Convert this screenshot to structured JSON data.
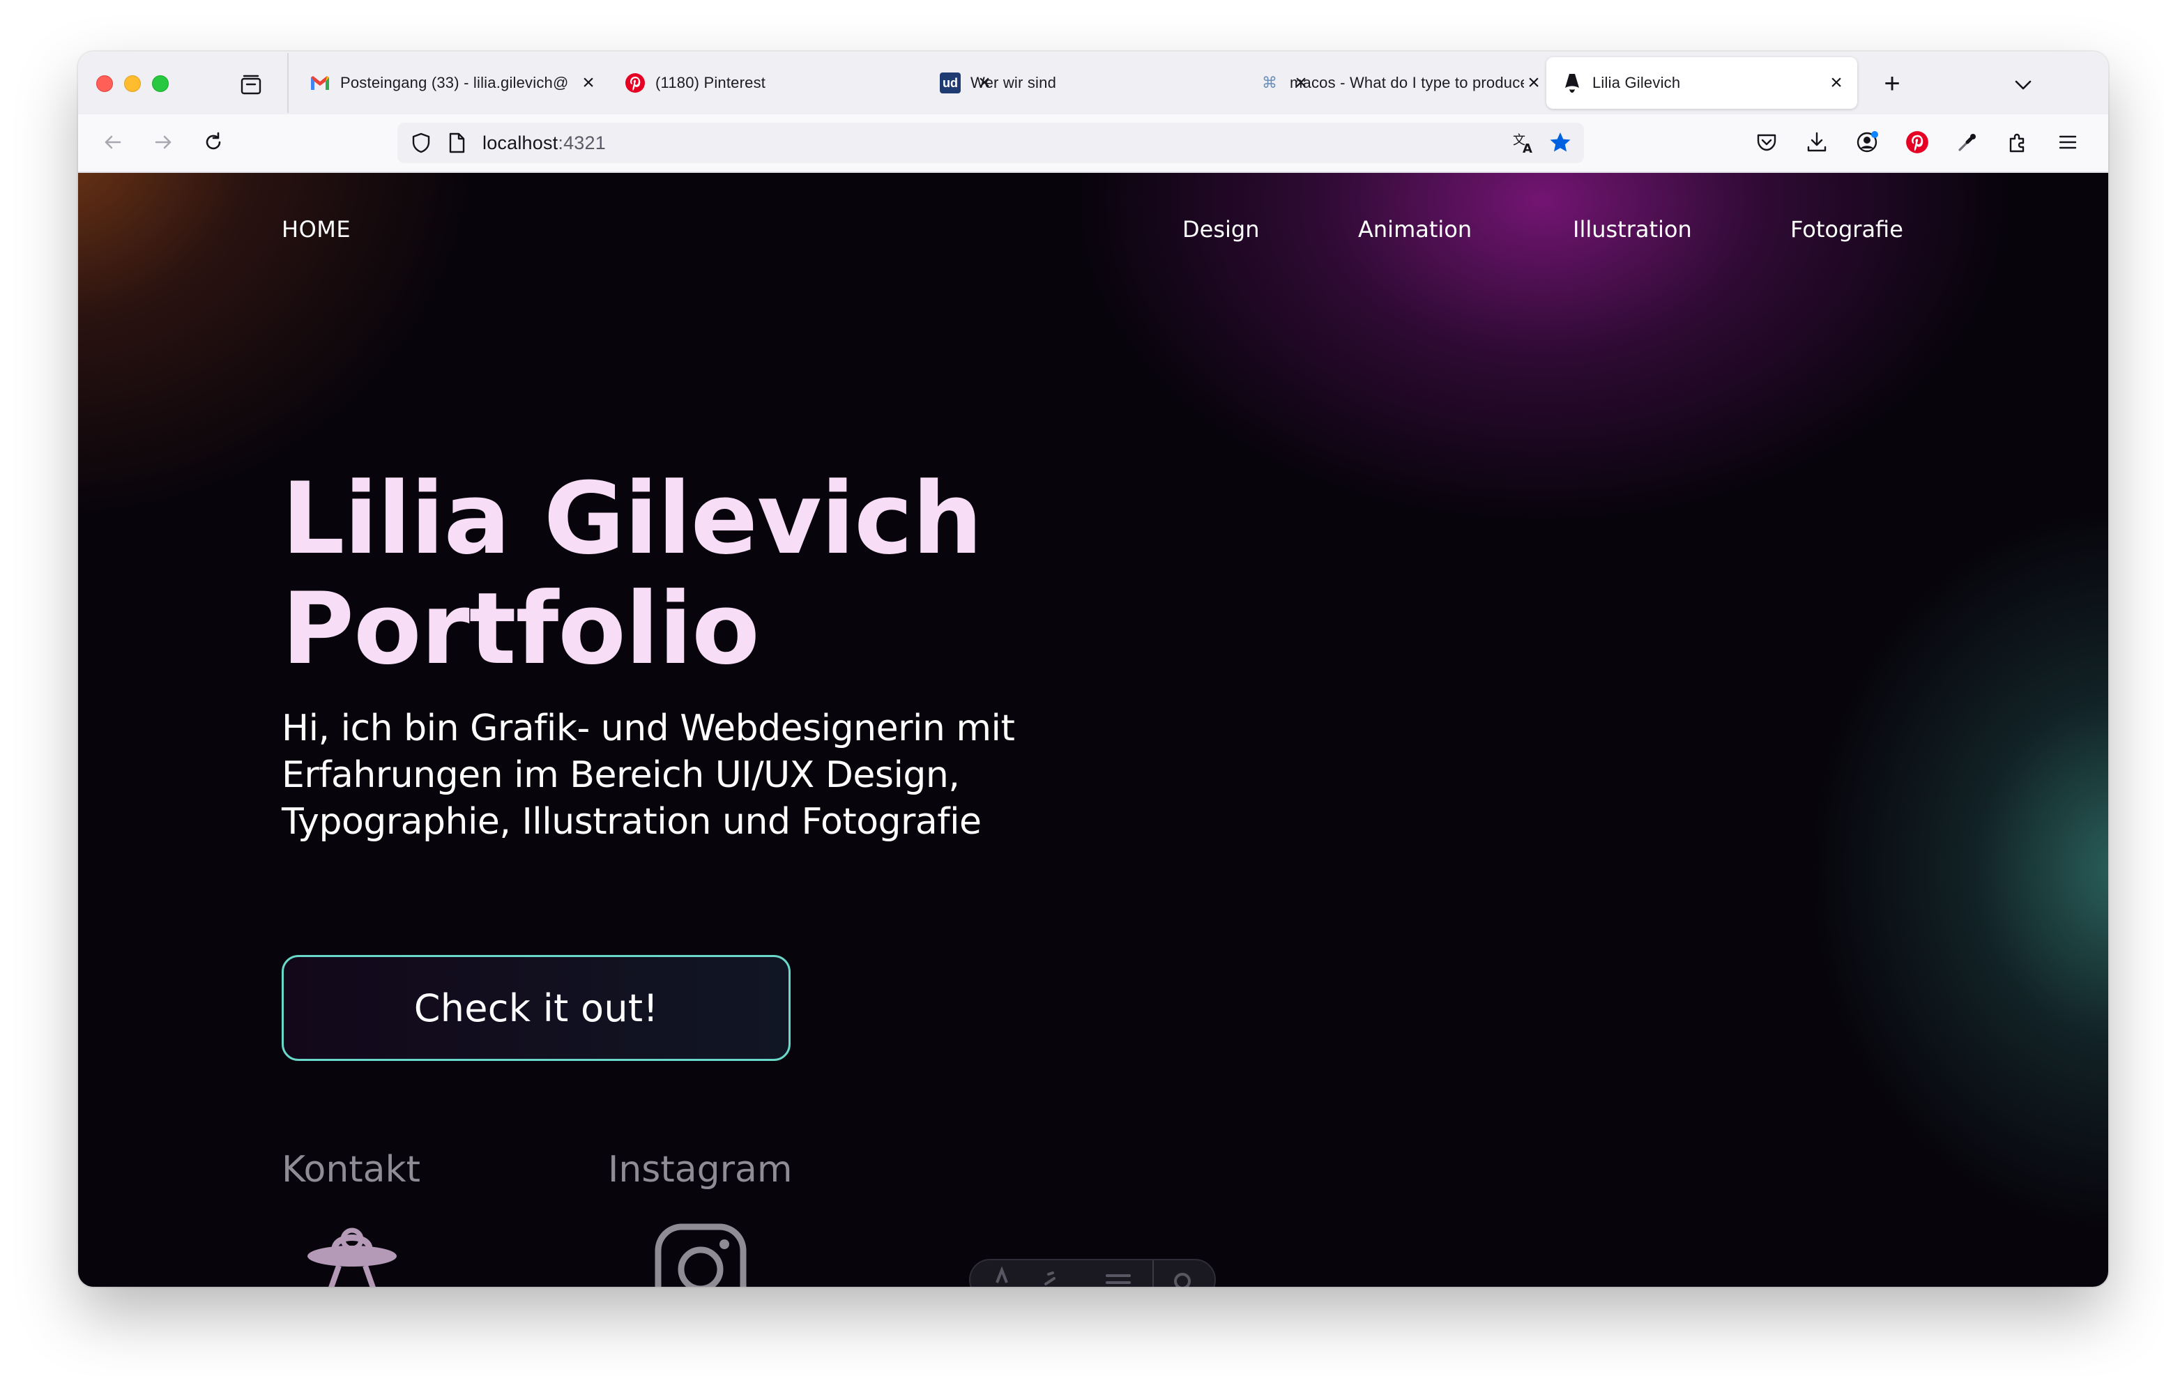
{
  "browser": {
    "tabs": [
      {
        "title": "Posteingang (33) - lilia.gilevich@",
        "icon": "gmail-icon"
      },
      {
        "title": "(1180) Pinterest",
        "icon": "pinterest-icon"
      },
      {
        "title": "Wer wir sind",
        "icon": "ud-icon"
      },
      {
        "title": "macos - What do I type to produce",
        "icon": "command-icon"
      },
      {
        "title": "Lilia Gilevich",
        "icon": "astro-icon",
        "active": true
      }
    ],
    "favicon_labels": {
      "gmail": "M",
      "ud": "ud",
      "command": "⌘"
    },
    "new_tab_symbol": "+",
    "close_symbol": "×",
    "url": {
      "host": "localhost",
      "port": ":4321"
    }
  },
  "site": {
    "nav": {
      "home": "HOME",
      "items": [
        "Design",
        "Animation",
        "Illustration",
        "Fotografie"
      ]
    },
    "hero": {
      "title_line1": "Lilia Gilevich",
      "title_line2": "Portfolio",
      "intro_line1": "Hi, ich bin Grafik- und Webdesignerin mit",
      "intro_line2": "Erfahrungen im Bereich UI/UX Design,",
      "intro_line3": "Typographie, Illustration und Fotografie",
      "cta": "Check it out!"
    },
    "links": {
      "contact": "Kontakt",
      "instagram": "Instagram"
    }
  },
  "colors": {
    "title": "#f7def6",
    "cta_border": "#6ad8c8",
    "page_bg": "#07040b"
  }
}
